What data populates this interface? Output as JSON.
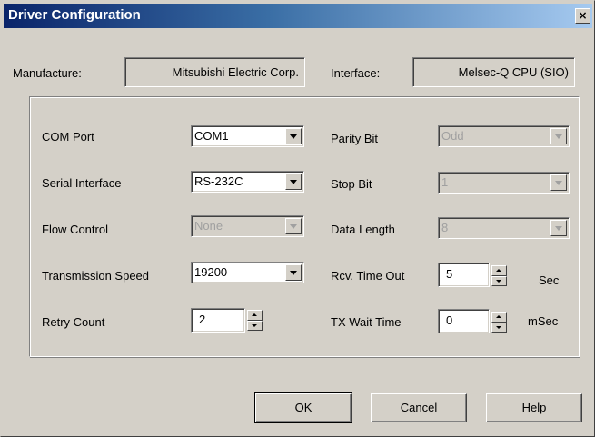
{
  "window": {
    "title": "Driver Configuration",
    "close_glyph": "×"
  },
  "header": {
    "manufacture_label": "Manufacture:",
    "manufacture_value": "Mitsubishi Electric Corp.",
    "interface_label": "Interface:",
    "interface_value": "Melsec-Q CPU (SIO)"
  },
  "settings": {
    "com_port": {
      "label": "COM Port",
      "value": "COM1",
      "enabled": true
    },
    "serial_interface": {
      "label": "Serial Interface",
      "value": "RS-232C",
      "enabled": true
    },
    "flow_control": {
      "label": "Flow Control",
      "value": "None",
      "enabled": false
    },
    "transmission_speed": {
      "label": "Transmission Speed",
      "value": "19200",
      "enabled": true
    },
    "retry_count": {
      "label": "Retry Count",
      "value": "2"
    },
    "parity_bit": {
      "label": "Parity Bit",
      "value": "Odd",
      "enabled": false
    },
    "stop_bit": {
      "label": "Stop Bit",
      "value": "1",
      "enabled": false
    },
    "data_length": {
      "label": "Data Length",
      "value": "8",
      "enabled": false
    },
    "rcv_time_out": {
      "label": "Rcv. Time Out",
      "value": "5",
      "unit": "Sec"
    },
    "tx_wait_time": {
      "label": "TX Wait Time",
      "value": "0",
      "unit": "mSec"
    }
  },
  "buttons": {
    "ok": "OK",
    "cancel": "Cancel",
    "help": "Help"
  },
  "colors": {
    "title_gradient_start": "#0a246a",
    "title_gradient_end": "#a6caf0",
    "face": "#d4d0c8"
  }
}
